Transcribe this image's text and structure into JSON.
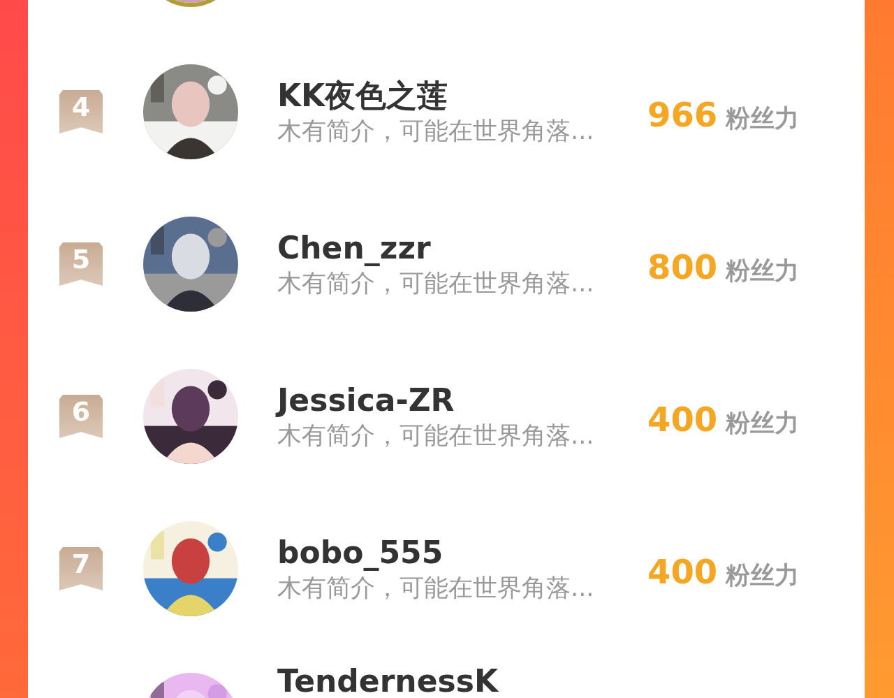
{
  "ranking": [
    {
      "gold_ring": true
    },
    {
      "rank": "4",
      "name": "KK夜色之莲",
      "bio": "木有简介，可能在世界角落...",
      "score": "966",
      "score_unit": "粉丝力",
      "gold_ring": false
    },
    {
      "rank": "5",
      "name": "Chen_zzr",
      "bio": "木有简介，可能在世界角落...",
      "score": "800",
      "score_unit": "粉丝力",
      "gold_ring": false
    },
    {
      "rank": "6",
      "name": "Jessica-ZR",
      "bio": "木有简介，可能在世界角落...",
      "score": "400",
      "score_unit": "粉丝力",
      "gold_ring": false
    },
    {
      "rank": "7",
      "name": "bobo_555",
      "bio": "木有简介，可能在世界角落...",
      "score": "400",
      "score_unit": "粉丝力",
      "gold_ring": false
    },
    {
      "name": "TendernessK",
      "gold_ring": false
    }
  ]
}
